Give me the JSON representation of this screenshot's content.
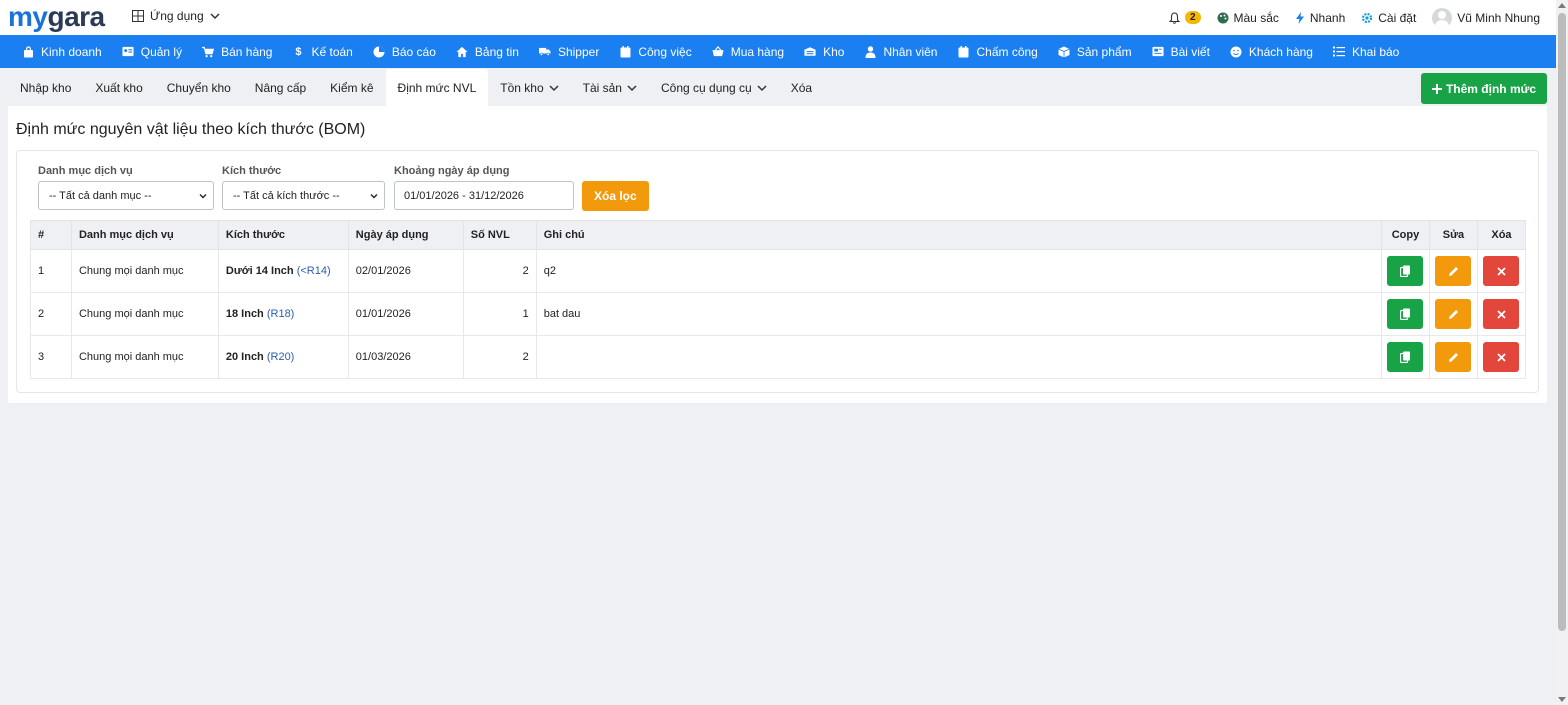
{
  "logo": {
    "my": "my",
    "gara": "gara"
  },
  "apps_menu": {
    "label": "Ứng dụng"
  },
  "top_right": {
    "notification_count": "2",
    "color_label": "Màu sắc",
    "quick_label": "Nhanh",
    "settings_label": "Cài đặt",
    "user_name": "Vũ Minh Nhung"
  },
  "main_nav": {
    "items": [
      {
        "label": "Kinh doanh",
        "icon": "bag-icon"
      },
      {
        "label": "Quản lý",
        "icon": "id-card-icon"
      },
      {
        "label": "Bán hàng",
        "icon": "cart-icon"
      },
      {
        "label": "Kế toán",
        "icon": "dollar-icon"
      },
      {
        "label": "Báo cáo",
        "icon": "pie-chart-icon"
      },
      {
        "label": "Bảng tin",
        "icon": "home-icon"
      },
      {
        "label": "Shipper",
        "icon": "truck-icon"
      },
      {
        "label": "Công việc",
        "icon": "calendar-icon"
      },
      {
        "label": "Mua hàng",
        "icon": "basket-icon"
      },
      {
        "label": "Kho",
        "icon": "warehouse-icon"
      },
      {
        "label": "Nhân viên",
        "icon": "user-icon"
      },
      {
        "label": "Chấm công",
        "icon": "calendar-check-icon"
      },
      {
        "label": "Sản phẩm",
        "icon": "box-icon"
      },
      {
        "label": "Bài viết",
        "icon": "newspaper-icon"
      },
      {
        "label": "Khách hàng",
        "icon": "smile-icon"
      },
      {
        "label": "Khai báo",
        "icon": "list-icon"
      }
    ]
  },
  "sub_tabs": {
    "items": [
      {
        "label": "Nhập kho"
      },
      {
        "label": "Xuất kho"
      },
      {
        "label": "Chuyển kho"
      },
      {
        "label": "Nâng cấp"
      },
      {
        "label": "Kiểm kê"
      },
      {
        "label": "Định mức NVL"
      },
      {
        "label": "Tồn kho"
      },
      {
        "label": "Tài sản"
      },
      {
        "label": "Công cụ dụng cụ"
      },
      {
        "label": "Xóa"
      }
    ],
    "active": "Định mức NVL"
  },
  "add_button": {
    "label": "Thêm định mức"
  },
  "page": {
    "title": "Định mức nguyên vật liệu theo kích thước (BOM)"
  },
  "filters": {
    "category": {
      "label": "Danh mục dịch vụ",
      "value": "-- Tất cả danh mục --"
    },
    "size": {
      "label": "Kích thước",
      "value": "-- Tất cả kích thước --"
    },
    "date_range": {
      "label": "Khoảng ngày áp dụng",
      "value": "01/01/2026 - 31/12/2026"
    },
    "clear_label": "Xóa lọc"
  },
  "table": {
    "headers": {
      "index": "#",
      "category": "Danh mục dịch vụ",
      "size": "Kích thước",
      "date": "Ngày áp dụng",
      "count": "Số NVL",
      "note": "Ghi chú",
      "copy": "Copy",
      "edit": "Sửa",
      "delete": "Xóa"
    },
    "rows": [
      {
        "index": "1",
        "category": "Chung mọi danh mục",
        "size_name": "Dưới 14 Inch",
        "size_code": "(<R14)",
        "date": "02/01/2026",
        "count": "2",
        "note": "q2"
      },
      {
        "index": "2",
        "category": "Chung mọi danh mục",
        "size_name": "18 Inch",
        "size_code": "(R18)",
        "date": "01/01/2026",
        "count": "1",
        "note": "bat dau"
      },
      {
        "index": "3",
        "category": "Chung mọi danh mục",
        "size_name": "20 Inch",
        "size_code": "(R20)",
        "date": "01/03/2026",
        "count": "2",
        "note": ""
      }
    ]
  },
  "colors": {
    "nav_blue": "#1a7ff0",
    "green": "#18a347",
    "orange": "#f29a0c",
    "red": "#e3463b"
  }
}
